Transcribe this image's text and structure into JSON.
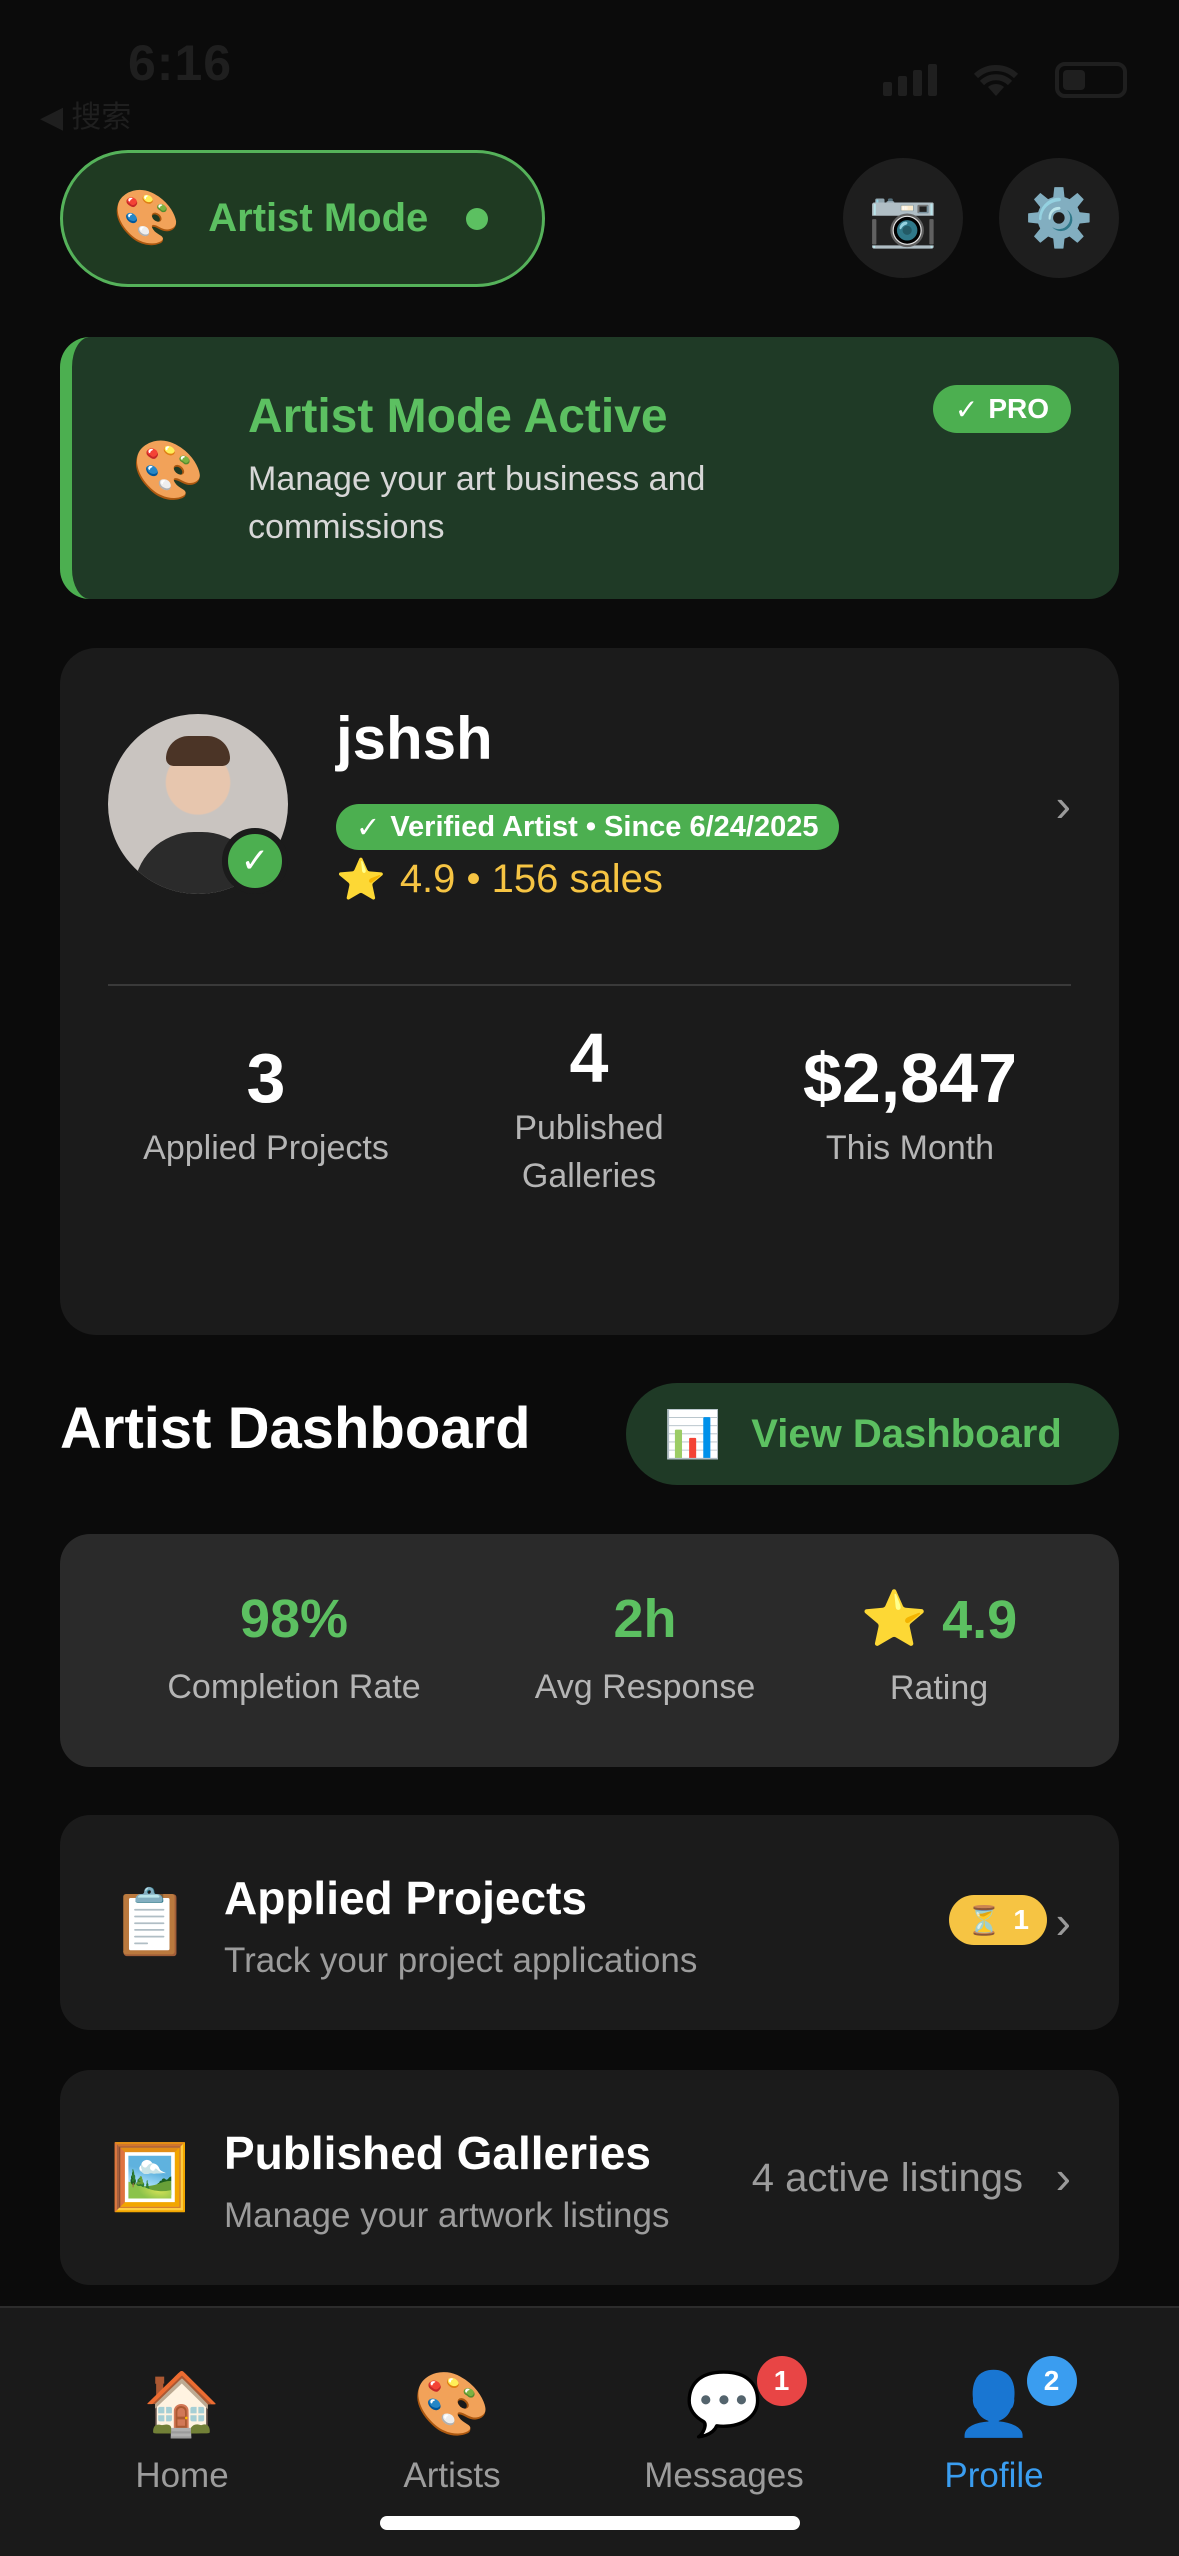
{
  "status_bar": {
    "time": "6:16",
    "back_label": "◀ 搜索"
  },
  "header": {
    "mode_icon": "🎨",
    "mode_label": "Artist Mode",
    "camera_icon": "📷",
    "settings_icon": "⚙️"
  },
  "banner": {
    "icon": "🎨",
    "title": "Artist Mode Active",
    "subtitle": "Manage your art business and commissions",
    "badge": "PRO",
    "badge_check": "✓"
  },
  "profile": {
    "username": "jshsh",
    "verified_label": "Verified Artist • Since 6/24/2025",
    "verified_check": "✓",
    "rating_star": "⭐",
    "rating_text": "4.9 • 156 sales",
    "avatar_check": "✓",
    "chevron": "›",
    "stats": [
      {
        "value": "3",
        "label": "Applied Projects"
      },
      {
        "value": "4",
        "label": "Published Galleries"
      },
      {
        "value": "$2,847",
        "label": "This Month"
      }
    ]
  },
  "dashboard": {
    "title": "Artist Dashboard",
    "button_icon": "📊",
    "button_label": "View Dashboard",
    "metrics": [
      {
        "value": "98%",
        "label": "Completion Rate"
      },
      {
        "value": "2h",
        "label": "Avg Response"
      },
      {
        "value": "4.9",
        "icon": "⭐",
        "label": "Rating"
      }
    ]
  },
  "cards": [
    {
      "icon": "📋",
      "title": "Applied Projects",
      "subtitle": "Track your project applications",
      "badge_icon": "⏳",
      "badge_count": "1",
      "chevron": "›"
    },
    {
      "icon": "🖼️",
      "title": "Published Galleries",
      "subtitle": "Manage your artwork listings",
      "meta": "4 active listings",
      "chevron": "›"
    }
  ],
  "tabs": [
    {
      "icon": "🏠",
      "label": "Home"
    },
    {
      "icon": "🎨",
      "label": "Artists"
    },
    {
      "icon": "💬",
      "label": "Messages",
      "badge": "1"
    },
    {
      "icon": "👤",
      "label": "Profile",
      "badge": "2",
      "active": true
    }
  ],
  "colors": {
    "accent_green": "#5cc061",
    "badge_red": "#e84545",
    "badge_blue": "#3a9df0",
    "active_tab": "#3a9df0",
    "pending_yellow": "#f6c443"
  }
}
